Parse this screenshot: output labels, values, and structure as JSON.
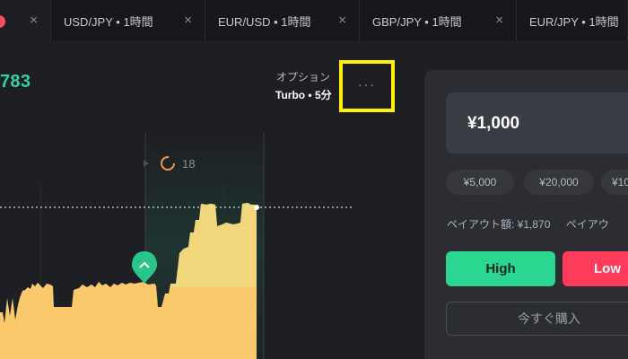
{
  "tabs": [
    {
      "label": "",
      "close": "×",
      "active": true
    },
    {
      "label": "USD/JPY • 1時間",
      "close": "×"
    },
    {
      "label": "EUR/USD • 1時間",
      "close": "×"
    },
    {
      "label": "GBP/JPY • 1時間",
      "close": "×"
    },
    {
      "label": "EUR/JPY • 1時間",
      "close": "×"
    }
  ],
  "price_readout": "783",
  "option": {
    "label": "オプション",
    "value": "Turbo • 5分",
    "more_icon": "ellipsis-icon",
    "more_label": "···"
  },
  "chart": {
    "countdown_value": "18",
    "marker_icon": "chevron-up-icon",
    "colors": {
      "area": "#f9c96b",
      "area_highlight": "#f1d77a",
      "entry_marker": "#2bc48a",
      "countdown": "#f2994a"
    }
  },
  "trade_panel": {
    "amount": "¥1,000",
    "presets": [
      "¥5,000",
      "¥20,000",
      "¥10"
    ],
    "payout_text": "ペイアウト額: ¥1,870",
    "payout_text_2": "ペイアウ",
    "high_label": "High",
    "low_label": "Low",
    "buy_now_label": "今すぐ購入"
  },
  "colors": {
    "price_green": "#2fd39a",
    "high": "#2bd690",
    "low": "#ff3b5c",
    "highlight_box": "#fff200"
  }
}
